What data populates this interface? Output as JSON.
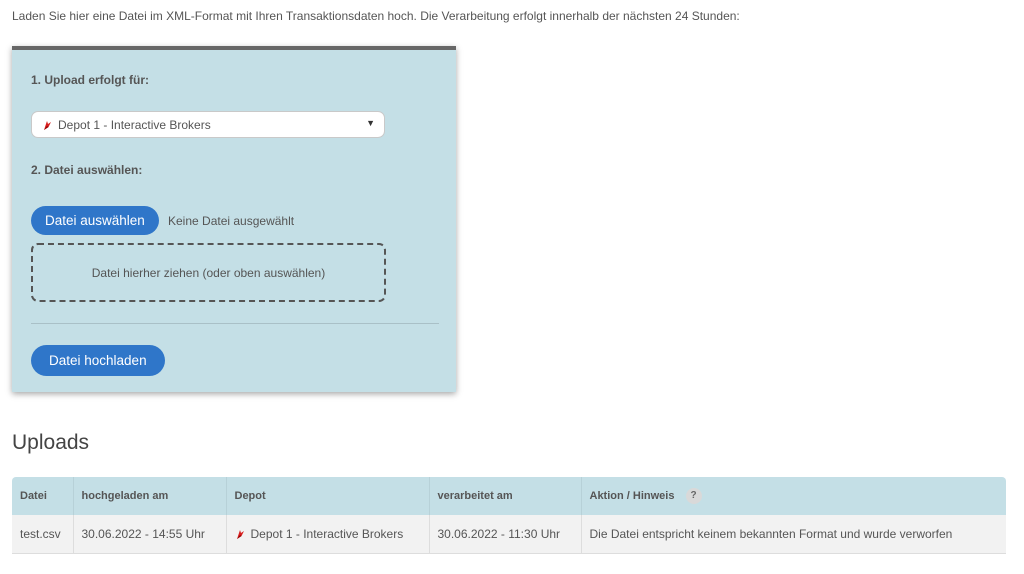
{
  "intro_text": "Laden Sie hier eine Datei im XML-Format mit Ihren Transaktionsdaten hoch. Die Verarbeitung erfolgt innerhalb der nächsten 24 Stunden:",
  "upload_form": {
    "step1_label": "1. Upload erfolgt für:",
    "depot_selected": "Depot 1 - Interactive Brokers",
    "select_arrow": "▼",
    "step2_label": "2. Datei auswählen:",
    "choose_file_button": "Datei auswählen",
    "no_file_text": "Keine Datei ausgewählt",
    "dropzone_text": "Datei hierher ziehen (oder oben auswählen)",
    "upload_button": "Datei hochladen"
  },
  "uploads": {
    "heading": "Uploads",
    "columns": [
      "Datei",
      "hochgeladen am",
      "Depot",
      "verarbeitet am",
      "Aktion / Hinweis"
    ],
    "help_badge": "?",
    "rows": [
      {
        "file": "test.csv",
        "uploaded": "30.06.2022 - 14:55 Uhr",
        "depot": "Depot 1 - Interactive Brokers",
        "processed": "30.06.2022 - 11:30 Uhr",
        "note": "Die Datei entspricht keinem bekannten Format und wurde verworfen"
      }
    ]
  },
  "colors": {
    "card_bg": "#c4dfe6",
    "button_blue": "#2f76c9",
    "error_red": "#e00000",
    "broker_icon_red": "#d81e1e"
  },
  "icons": {
    "broker": "interactive-brokers-logo-icon",
    "dropdown": "chevron-down-icon",
    "help": "question-mark-icon"
  }
}
